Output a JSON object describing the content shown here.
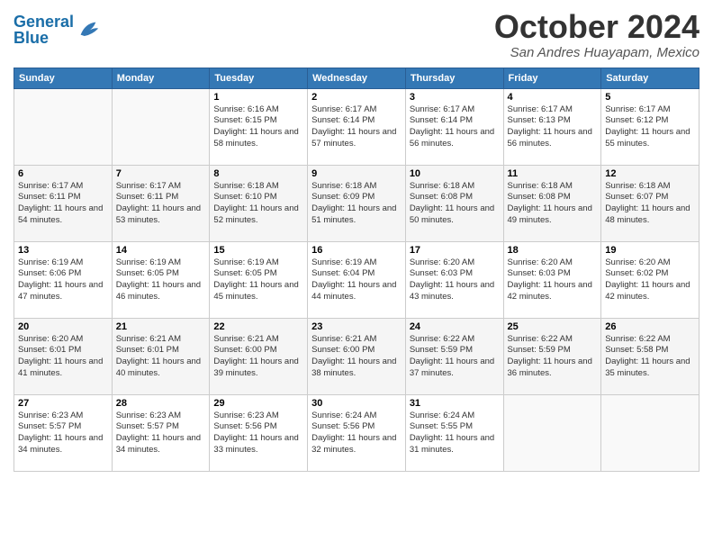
{
  "header": {
    "logo_line1": "General",
    "logo_line2": "Blue",
    "month": "October 2024",
    "location": "San Andres Huayapam, Mexico"
  },
  "days_of_week": [
    "Sunday",
    "Monday",
    "Tuesday",
    "Wednesday",
    "Thursday",
    "Friday",
    "Saturday"
  ],
  "weeks": [
    [
      {
        "day": "",
        "info": ""
      },
      {
        "day": "",
        "info": ""
      },
      {
        "day": "1",
        "info": "Sunrise: 6:16 AM\nSunset: 6:15 PM\nDaylight: 11 hours and 58 minutes."
      },
      {
        "day": "2",
        "info": "Sunrise: 6:17 AM\nSunset: 6:14 PM\nDaylight: 11 hours and 57 minutes."
      },
      {
        "day": "3",
        "info": "Sunrise: 6:17 AM\nSunset: 6:14 PM\nDaylight: 11 hours and 56 minutes."
      },
      {
        "day": "4",
        "info": "Sunrise: 6:17 AM\nSunset: 6:13 PM\nDaylight: 11 hours and 56 minutes."
      },
      {
        "day": "5",
        "info": "Sunrise: 6:17 AM\nSunset: 6:12 PM\nDaylight: 11 hours and 55 minutes."
      }
    ],
    [
      {
        "day": "6",
        "info": "Sunrise: 6:17 AM\nSunset: 6:11 PM\nDaylight: 11 hours and 54 minutes."
      },
      {
        "day": "7",
        "info": "Sunrise: 6:17 AM\nSunset: 6:11 PM\nDaylight: 11 hours and 53 minutes."
      },
      {
        "day": "8",
        "info": "Sunrise: 6:18 AM\nSunset: 6:10 PM\nDaylight: 11 hours and 52 minutes."
      },
      {
        "day": "9",
        "info": "Sunrise: 6:18 AM\nSunset: 6:09 PM\nDaylight: 11 hours and 51 minutes."
      },
      {
        "day": "10",
        "info": "Sunrise: 6:18 AM\nSunset: 6:08 PM\nDaylight: 11 hours and 50 minutes."
      },
      {
        "day": "11",
        "info": "Sunrise: 6:18 AM\nSunset: 6:08 PM\nDaylight: 11 hours and 49 minutes."
      },
      {
        "day": "12",
        "info": "Sunrise: 6:18 AM\nSunset: 6:07 PM\nDaylight: 11 hours and 48 minutes."
      }
    ],
    [
      {
        "day": "13",
        "info": "Sunrise: 6:19 AM\nSunset: 6:06 PM\nDaylight: 11 hours and 47 minutes."
      },
      {
        "day": "14",
        "info": "Sunrise: 6:19 AM\nSunset: 6:05 PM\nDaylight: 11 hours and 46 minutes."
      },
      {
        "day": "15",
        "info": "Sunrise: 6:19 AM\nSunset: 6:05 PM\nDaylight: 11 hours and 45 minutes."
      },
      {
        "day": "16",
        "info": "Sunrise: 6:19 AM\nSunset: 6:04 PM\nDaylight: 11 hours and 44 minutes."
      },
      {
        "day": "17",
        "info": "Sunrise: 6:20 AM\nSunset: 6:03 PM\nDaylight: 11 hours and 43 minutes."
      },
      {
        "day": "18",
        "info": "Sunrise: 6:20 AM\nSunset: 6:03 PM\nDaylight: 11 hours and 42 minutes."
      },
      {
        "day": "19",
        "info": "Sunrise: 6:20 AM\nSunset: 6:02 PM\nDaylight: 11 hours and 42 minutes."
      }
    ],
    [
      {
        "day": "20",
        "info": "Sunrise: 6:20 AM\nSunset: 6:01 PM\nDaylight: 11 hours and 41 minutes."
      },
      {
        "day": "21",
        "info": "Sunrise: 6:21 AM\nSunset: 6:01 PM\nDaylight: 11 hours and 40 minutes."
      },
      {
        "day": "22",
        "info": "Sunrise: 6:21 AM\nSunset: 6:00 PM\nDaylight: 11 hours and 39 minutes."
      },
      {
        "day": "23",
        "info": "Sunrise: 6:21 AM\nSunset: 6:00 PM\nDaylight: 11 hours and 38 minutes."
      },
      {
        "day": "24",
        "info": "Sunrise: 6:22 AM\nSunset: 5:59 PM\nDaylight: 11 hours and 37 minutes."
      },
      {
        "day": "25",
        "info": "Sunrise: 6:22 AM\nSunset: 5:59 PM\nDaylight: 11 hours and 36 minutes."
      },
      {
        "day": "26",
        "info": "Sunrise: 6:22 AM\nSunset: 5:58 PM\nDaylight: 11 hours and 35 minutes."
      }
    ],
    [
      {
        "day": "27",
        "info": "Sunrise: 6:23 AM\nSunset: 5:57 PM\nDaylight: 11 hours and 34 minutes."
      },
      {
        "day": "28",
        "info": "Sunrise: 6:23 AM\nSunset: 5:57 PM\nDaylight: 11 hours and 34 minutes."
      },
      {
        "day": "29",
        "info": "Sunrise: 6:23 AM\nSunset: 5:56 PM\nDaylight: 11 hours and 33 minutes."
      },
      {
        "day": "30",
        "info": "Sunrise: 6:24 AM\nSunset: 5:56 PM\nDaylight: 11 hours and 32 minutes."
      },
      {
        "day": "31",
        "info": "Sunrise: 6:24 AM\nSunset: 5:55 PM\nDaylight: 11 hours and 31 minutes."
      },
      {
        "day": "",
        "info": ""
      },
      {
        "day": "",
        "info": ""
      }
    ]
  ]
}
